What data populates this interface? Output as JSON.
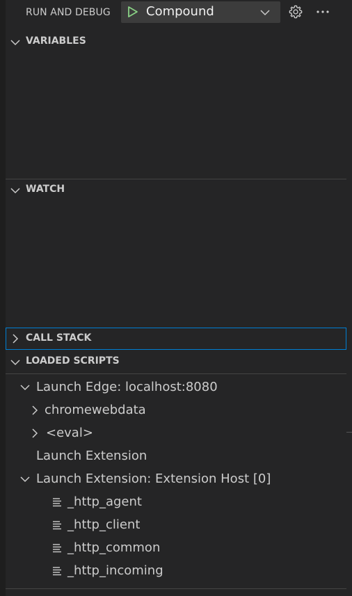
{
  "header": {
    "title": "RUN AND DEBUG",
    "config_name": "Compound",
    "icons": [
      "play-icon",
      "chevron-down-icon",
      "gear-icon",
      "ellipsis-icon"
    ]
  },
  "sections": {
    "variables": {
      "title": "VARIABLES",
      "expanded": true
    },
    "watch": {
      "title": "WATCH",
      "expanded": true
    },
    "call_stack": {
      "title": "CALL STACK",
      "expanded": false
    },
    "loaded_scripts": {
      "title": "LOADED SCRIPTS",
      "expanded": true
    }
  },
  "loaded_scripts_tree": [
    {
      "label": "Launch Edge: localhost:8080",
      "level": 1,
      "state": "expanded"
    },
    {
      "label": "chromewebdata",
      "level": 2,
      "state": "collapsed"
    },
    {
      "label": "<eval>",
      "level": 2,
      "state": "collapsed"
    },
    {
      "label": "Launch Extension",
      "level": 1,
      "state": "leaf"
    },
    {
      "label": "Launch Extension: Extension Host [0]",
      "level": 1,
      "state": "expanded"
    },
    {
      "label": "_http_agent",
      "level": 3,
      "state": "file"
    },
    {
      "label": "_http_client",
      "level": 3,
      "state": "file"
    },
    {
      "label": "_http_common",
      "level": 3,
      "state": "file"
    },
    {
      "label": "_http_incoming",
      "level": 3,
      "state": "file"
    }
  ],
  "colors": {
    "background": "#252526",
    "play_green": "#89d185",
    "focus_border": "#007fd4"
  }
}
